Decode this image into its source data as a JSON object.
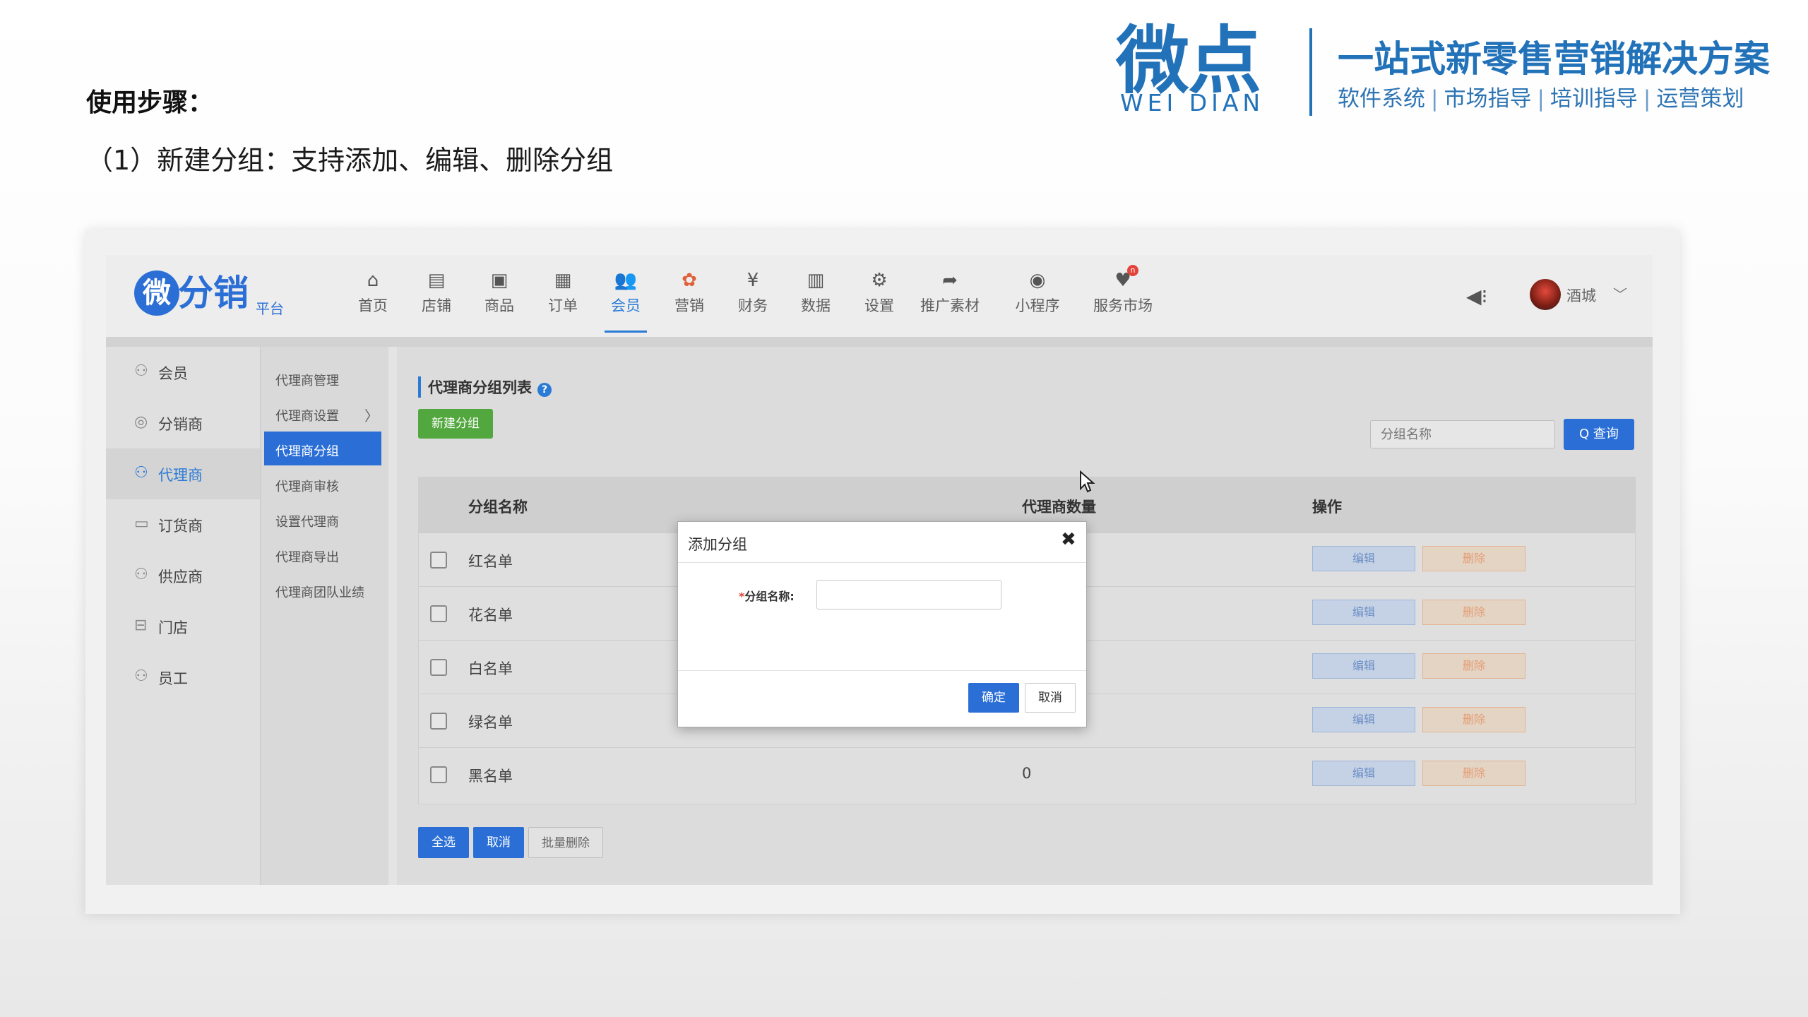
{
  "slide": {
    "steps_title": "使用步骤：",
    "step_line": "（1）新建分组：支持添加、编辑、删除分组"
  },
  "brand": {
    "logo_cn": "微点",
    "logo_en": "WEI DIAN",
    "slogan": "一站式新零售营销解决方案",
    "tags": [
      "软件系统",
      "市场指导",
      "培训指导",
      "运营策划"
    ],
    "color": "#2272b9"
  },
  "app": {
    "logo_badge": "微",
    "logo_main": "分销",
    "logo_sub": "平台",
    "accent": "#2b6fd6",
    "nav": [
      {
        "label": "首页",
        "icon": "home-icon",
        "glyph": "⌂"
      },
      {
        "label": "店铺",
        "icon": "store-icon",
        "glyph": "▤"
      },
      {
        "label": "商品",
        "icon": "goods-icon",
        "glyph": "▣"
      },
      {
        "label": "订单",
        "icon": "order-icon",
        "glyph": "▦"
      },
      {
        "label": "会员",
        "icon": "member-icon",
        "glyph": "👥",
        "active": true
      },
      {
        "label": "营销",
        "icon": "marketing-icon",
        "glyph": "✿"
      },
      {
        "label": "财务",
        "icon": "finance-icon",
        "glyph": "¥"
      },
      {
        "label": "数据",
        "icon": "data-icon",
        "glyph": "▥"
      },
      {
        "label": "设置",
        "icon": "settings-icon",
        "glyph": "⚙"
      },
      {
        "label": "推广素材",
        "icon": "share-icon",
        "glyph": "➦"
      },
      {
        "label": "小程序",
        "icon": "miniprogram-icon",
        "glyph": "◉"
      },
      {
        "label": "服务市场",
        "icon": "market-icon",
        "glyph": "♥",
        "badge": "n"
      }
    ],
    "user_name": "酒城",
    "speaker_icon": "speaker-icon",
    "sidebar": [
      {
        "label": "会员",
        "icon": "member-icon",
        "glyph": "⚇"
      },
      {
        "label": "分销商",
        "icon": "distributor-icon",
        "glyph": "◎"
      },
      {
        "label": "代理商",
        "icon": "agent-icon",
        "glyph": "⚇",
        "active": true
      },
      {
        "label": "订货商",
        "icon": "orderer-icon",
        "glyph": "▭"
      },
      {
        "label": "供应商",
        "icon": "supplier-icon",
        "glyph": "⚇"
      },
      {
        "label": "门店",
        "icon": "shop-icon",
        "glyph": "⊟"
      },
      {
        "label": "员工",
        "icon": "staff-icon",
        "glyph": "⚇"
      }
    ],
    "submenu": [
      {
        "label": "代理商管理"
      },
      {
        "label": "代理商设置",
        "arrow": "〉"
      },
      {
        "label": "代理商分组",
        "active": true
      },
      {
        "label": "代理商审核"
      },
      {
        "label": "设置代理商"
      },
      {
        "label": "代理商导出"
      },
      {
        "label": "代理商团队业绩"
      }
    ],
    "content": {
      "title": "代理商分组列表",
      "help": "?",
      "new_button": "新建分组",
      "search_placeholder": "分组名称",
      "search_button": "Q 查询",
      "columns": [
        "分组名称",
        "代理商数量",
        "操作"
      ],
      "rows": [
        {
          "name": "红名单",
          "count": ""
        },
        {
          "name": "花名单",
          "count": ""
        },
        {
          "name": "白名单",
          "count": ""
        },
        {
          "name": "绿名单",
          "count": ""
        },
        {
          "name": "黑名单",
          "count": "0"
        }
      ],
      "edit_label": "编辑",
      "delete_label": "删除",
      "select_all": "全选",
      "cancel": "取消",
      "batch_delete": "批量删除"
    },
    "modal": {
      "title": "添加分组",
      "close": "✖",
      "required_mark": "*",
      "field_label": "分组名称:",
      "field_value": "",
      "ok": "确定",
      "cancel": "取消"
    }
  }
}
